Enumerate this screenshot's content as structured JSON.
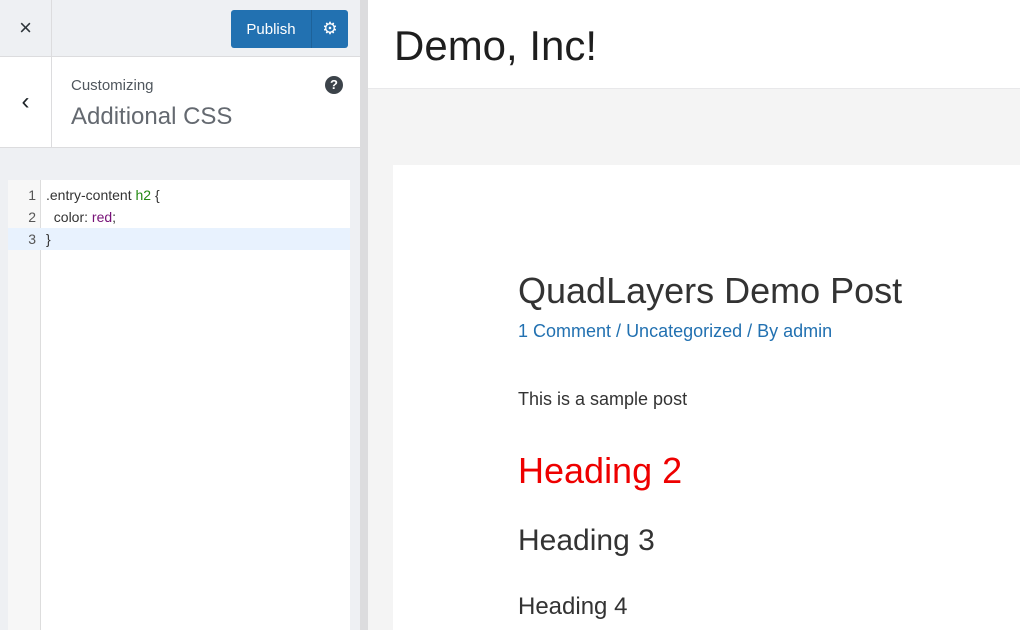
{
  "sidebar": {
    "close_icon": "×",
    "publish_label": "Publish",
    "gear_icon": "⚙",
    "back_icon": "‹",
    "customizing": "Customizing",
    "section_title": "Additional CSS",
    "help_icon": "?",
    "code_lines": [
      {
        "num": "1",
        "sel": ".entry-content ",
        "tag": "h2",
        "rest": " {"
      },
      {
        "num": "2",
        "prop": "  color: ",
        "val": "red",
        "end": ";"
      },
      {
        "num": "3",
        "text": "}"
      }
    ]
  },
  "preview": {
    "site_title": "Demo, Inc!",
    "post_title": "QuadLayers Demo Post",
    "meta": {
      "comments": "1 Comment",
      "sep1": " / ",
      "category": "Uncategorized",
      "sep2": " / By ",
      "author": "admin"
    },
    "excerpt": "This is a sample post",
    "h2": "Heading 2",
    "h3": "Heading 3",
    "h4": "Heading 4"
  },
  "colors": {
    "accent": "#2271b1",
    "heading2": "#ee0000"
  }
}
